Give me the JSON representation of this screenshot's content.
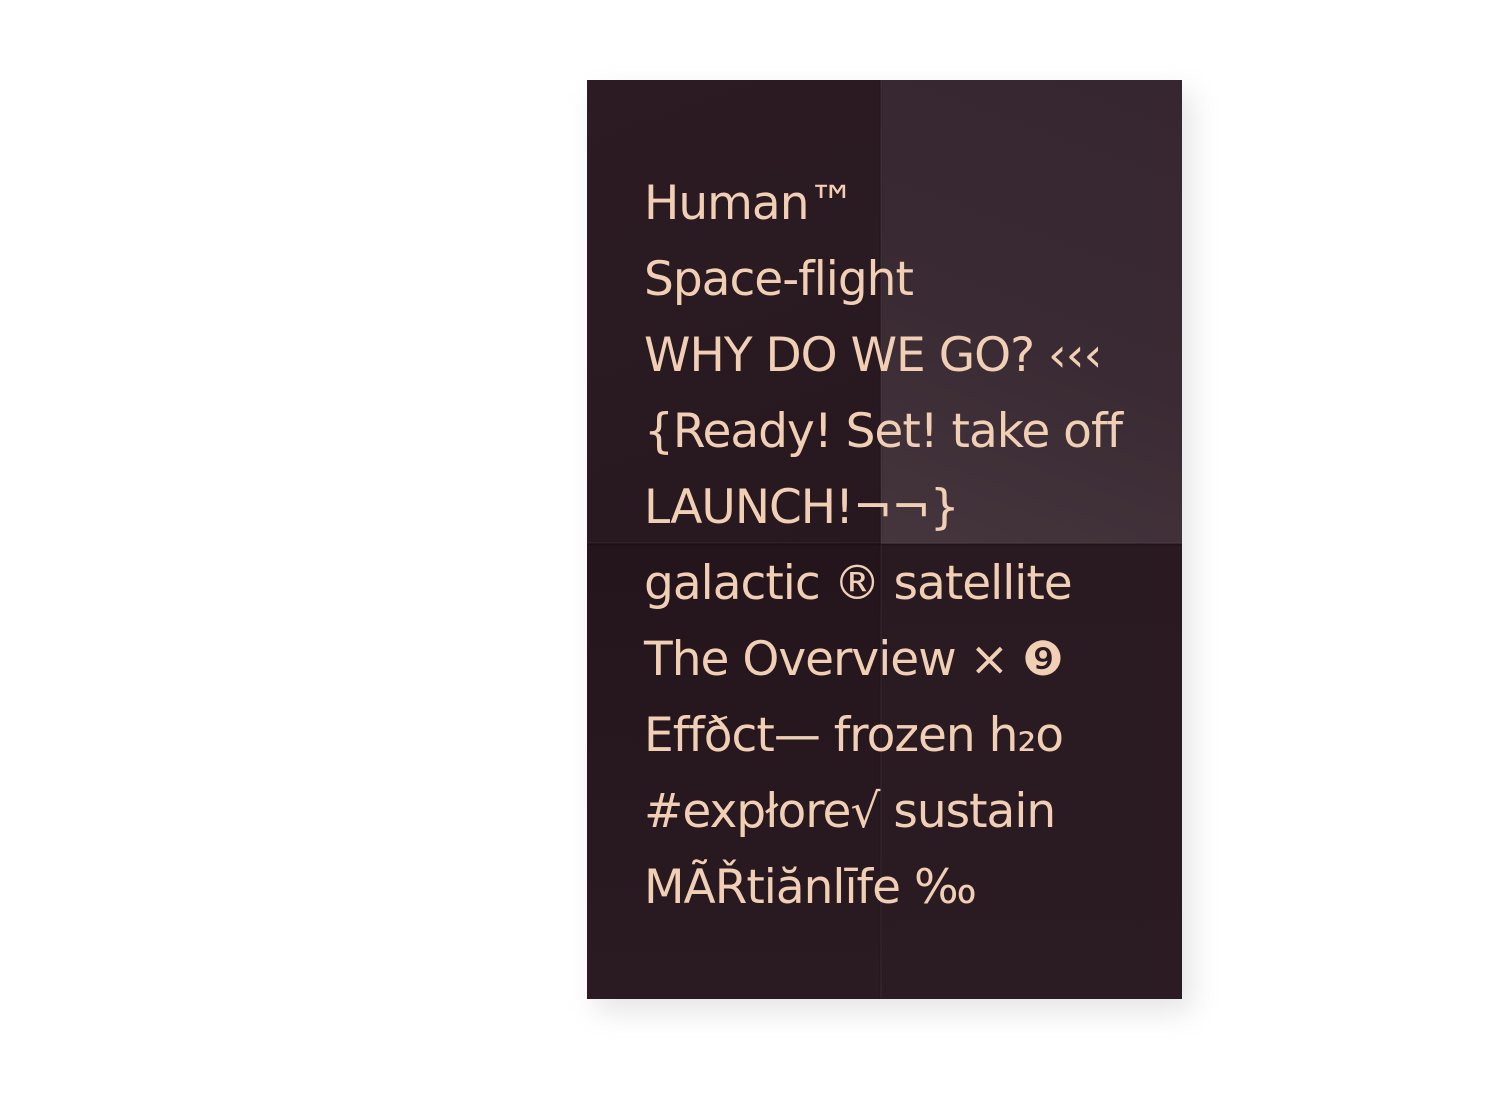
{
  "poster": {
    "colors": {
      "background": "#2a1a22",
      "text": "#f1cfb5",
      "page": "#ffffff"
    },
    "lines": [
      "Human™",
      "Space-flight",
      "WHY DO WE GO? ‹‹‹",
      "{Ready! Set! take off",
      "LAUNCH!¬¬}",
      "galactic ® satellite",
      "The Overview  × ❾",
      "Effðct— frozen h₂o",
      "#expłore√ sustain",
      "MÃŘtiănlīfe ‰"
    ]
  }
}
